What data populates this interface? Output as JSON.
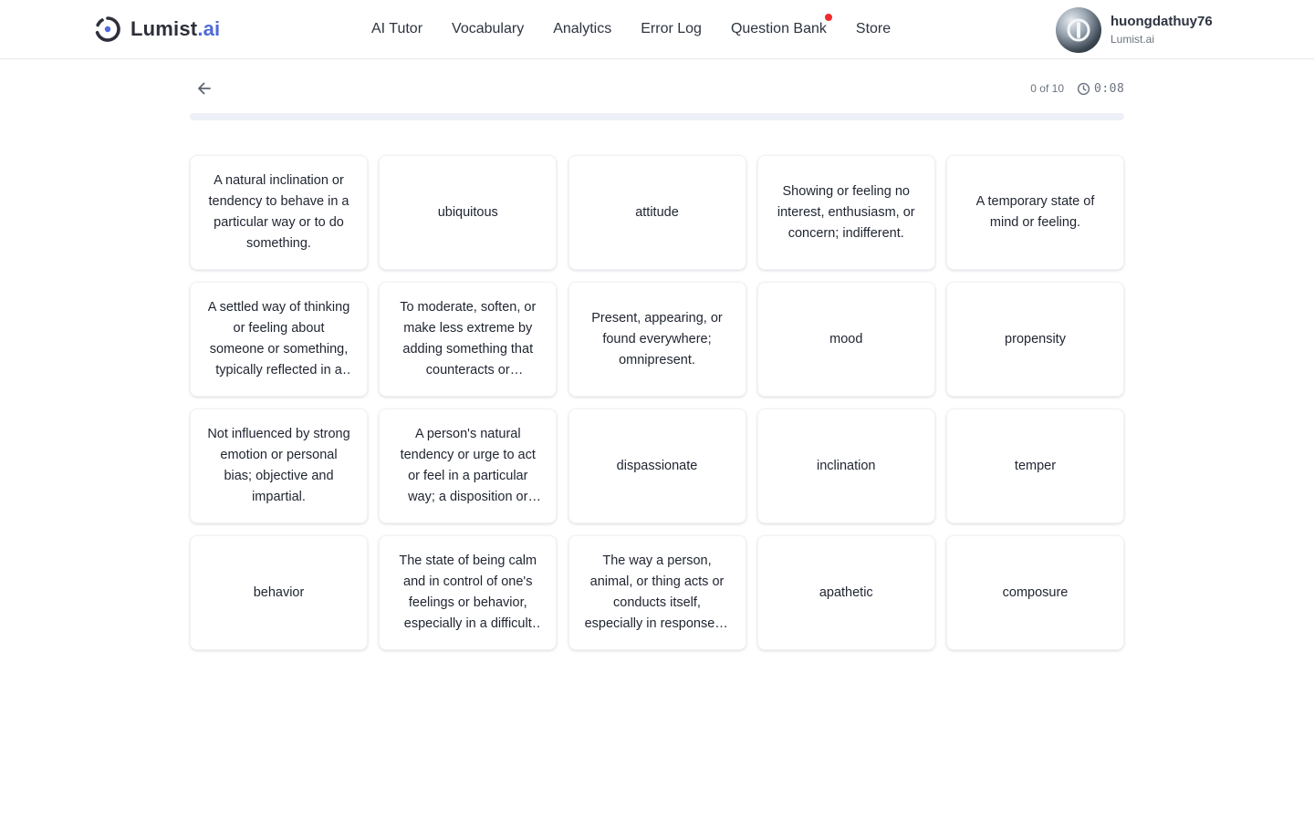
{
  "brand": {
    "name": "Lumist",
    "suffix": ".ai",
    "accent_color": "#4f6bd8"
  },
  "nav": {
    "items": [
      {
        "label": "AI Tutor"
      },
      {
        "label": "Vocabulary"
      },
      {
        "label": "Analytics"
      },
      {
        "label": "Error Log"
      },
      {
        "label": "Question Bank",
        "notification_dot": true
      },
      {
        "label": "Store"
      }
    ]
  },
  "user": {
    "name": "huongdathuy76",
    "subtitle": "Lumist.ai"
  },
  "quiz": {
    "progress_text": "0 of 10",
    "progress_fraction": 0,
    "timer": "0:08"
  },
  "cards": [
    {
      "text": "A natural inclination or tendency to behave in a particular way or to do something."
    },
    {
      "text": "ubiquitous"
    },
    {
      "text": "attitude"
    },
    {
      "text": "Showing or feeling no interest, enthusiasm, or concern; indifferent."
    },
    {
      "text": "A temporary state of mind or feeling."
    },
    {
      "text": "A settled way of thinking or feeling about someone or something, typically reflected in a person's behavior."
    },
    {
      "text": "To moderate, soften, or make less extreme by adding something that counteracts or neutralizes."
    },
    {
      "text": "Present, appearing, or found everywhere; omnipresent."
    },
    {
      "text": "mood"
    },
    {
      "text": "propensity"
    },
    {
      "text": "Not influenced by strong emotion or personal bias; objective and impartial."
    },
    {
      "text": "A person's natural tendency or urge to act or feel in a particular way; a disposition or preference."
    },
    {
      "text": "dispassionate"
    },
    {
      "text": "inclination"
    },
    {
      "text": "temper"
    },
    {
      "text": "behavior"
    },
    {
      "text": "The state of being calm and in control of one's feelings or behavior, especially in a difficult situation."
    },
    {
      "text": "The way a person, animal, or thing acts or conducts itself, especially in response to a situation."
    },
    {
      "text": "apathetic"
    },
    {
      "text": "composure"
    }
  ]
}
